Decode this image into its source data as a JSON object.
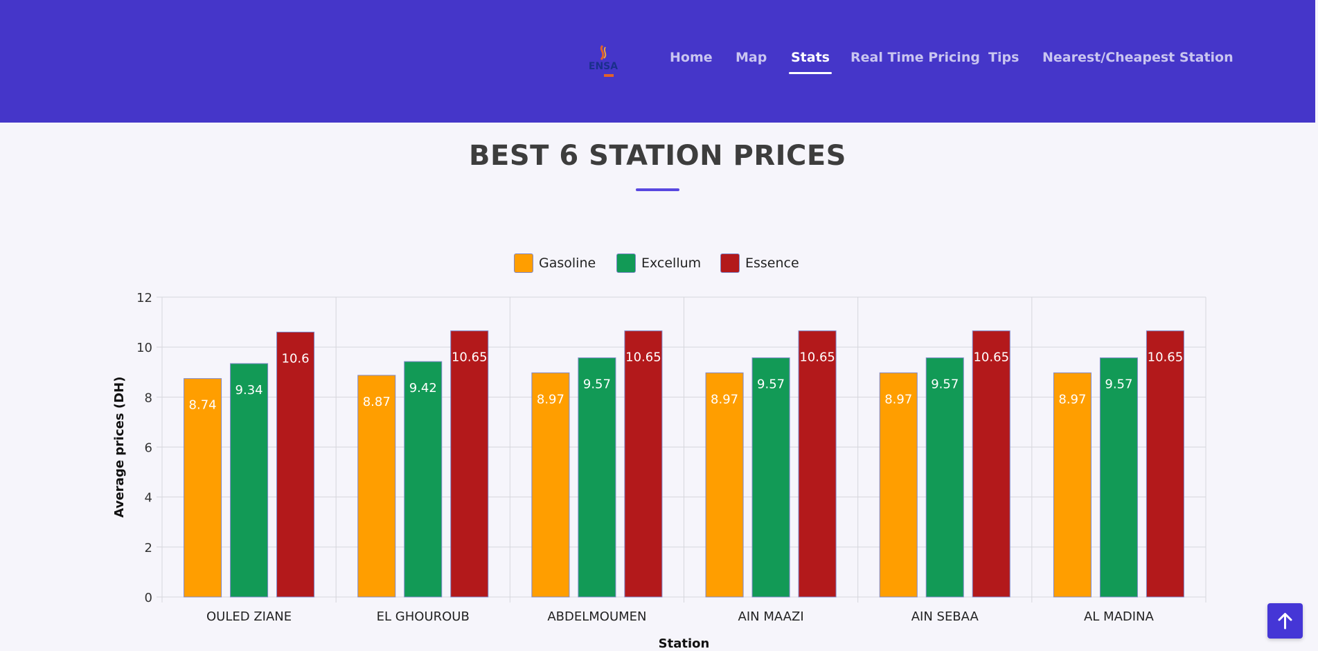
{
  "nav": {
    "logo_text": "ENSA",
    "items": [
      "Home",
      "Map",
      "Stats",
      "Real Time Pricing",
      "Tips",
      "Nearest/Cheapest Station"
    ],
    "active": "Stats"
  },
  "section": {
    "title": "BEST 6 STATION PRICES"
  },
  "colors": {
    "header_bg": "#4536c9",
    "accent": "#5848e0",
    "Gasoline": "#ff9e00",
    "Excellum": "#129a56",
    "Essence": "#b3191b"
  },
  "icons": {
    "scroll_top": "arrow-up-icon"
  },
  "chart_data": {
    "type": "bar",
    "title": "",
    "xlabel": "Station",
    "ylabel": "Average prices (DH)",
    "ylim": [
      0,
      12
    ],
    "yticks": [
      0,
      2,
      4,
      6,
      8,
      10,
      12
    ],
    "legend_position": "top-center",
    "grid": true,
    "categories": [
      "OULED ZIANE",
      "EL GHOUROUB",
      "ABDELMOUMEN",
      "AIN MAAZI",
      "AIN SEBAA",
      "AL MADINA"
    ],
    "series": [
      {
        "name": "Gasoline",
        "values": [
          8.74,
          8.87,
          8.97,
          8.97,
          8.97,
          8.97
        ]
      },
      {
        "name": "Excellum",
        "values": [
          9.34,
          9.42,
          9.57,
          9.57,
          9.57,
          9.57
        ]
      },
      {
        "name": "Essence",
        "values": [
          10.6,
          10.65,
          10.65,
          10.65,
          10.65,
          10.65
        ]
      }
    ]
  }
}
